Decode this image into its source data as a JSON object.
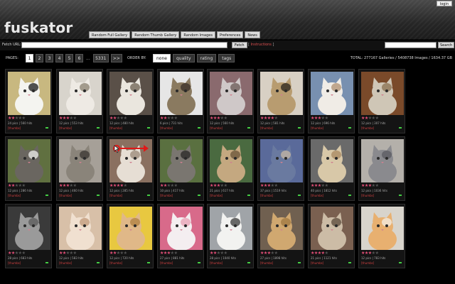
{
  "header": {
    "logo": "fuskator",
    "login_label": "login",
    "tabs": [
      "Random Full Gallery",
      "Random Thumb Gallery",
      "Random Images",
      "Preferences",
      "News"
    ]
  },
  "fetch": {
    "label": "Fetch URL:",
    "button": "Fetch",
    "instructions_prefix": "[ ",
    "instructions": "Instructions",
    "instructions_suffix": " ]",
    "search_button": "Search"
  },
  "pager": {
    "label": "PAGES:",
    "pages": [
      "1",
      "2",
      "3",
      "4",
      "5",
      "6"
    ],
    "active_page": "1",
    "ellipsis": "...",
    "last_page": "5331",
    "next": ">>",
    "order_label": "ORDER BY:",
    "order_options": [
      "none",
      "quality",
      "rating",
      "tags"
    ],
    "active_order": "none",
    "total": "TOTAL: 277167 Galleries / 5408738 Images / 1634.37 GB"
  },
  "colors": {
    "accent": "#e8507a",
    "link": "#d04040",
    "background": "#000000"
  },
  "annotation": {
    "icon": "red-arrow-annotation",
    "cursor": "hand-cursor-icon"
  },
  "galleries": [
    {
      "info": "24 pics | 560 hits",
      "rating": 2,
      "votes": "",
      "thumbs": "[thumbs]",
      "bg": "#c8b880",
      "cat": "#f4f4f0",
      "patch": "#1a1a1a"
    },
    {
      "info": "12 pics | 553 hits",
      "rating": 3,
      "votes": "",
      "thumbs": "[thumbs]",
      "bg": "#d8d4cc",
      "cat": "#eeeae4",
      "patch": "#8a8070"
    },
    {
      "info": "12 pics | 480 hits",
      "rating": 2,
      "votes": "",
      "thumbs": "[thumbs]",
      "bg": "#5a5048",
      "cat": "#eae6de",
      "patch": "#6c6050"
    },
    {
      "info": "6 pics | 731 hits",
      "rating": 2,
      "votes": "",
      "thumbs": "[thumbs]",
      "bg": "#e6e6e6",
      "cat": "#8a7a60",
      "patch": "#3a3028"
    },
    {
      "info": "12 pics | 560 hits",
      "rating": 3,
      "votes": "",
      "thumbs": "[thumbs]",
      "bg": "#8a6a6e",
      "cat": "#cfc8c8",
      "patch": "#6a5a56"
    },
    {
      "info": "12 pics | 581 hits",
      "rating": 4,
      "votes": "",
      "thumbs": "[thumbs]",
      "bg": "#d8d0c4",
      "cat": "#b89c70",
      "patch": "#2a241e"
    },
    {
      "info": "12 pics | 696 hits",
      "rating": 3,
      "votes": "",
      "thumbs": "[thumbs]",
      "bg": "#7890b0",
      "cat": "#f0ece6",
      "patch": "#b09070"
    },
    {
      "info": "12 pics | 307 hits",
      "rating": 2,
      "votes": "",
      "thumbs": "[thumbs]",
      "bg": "#7a4a2a",
      "cat": "#cfc6b6",
      "patch": "#8a7050"
    },
    {
      "info": "12 pics | 286 hits",
      "rating": 2,
      "votes": "",
      "thumbs": "[thumbs]",
      "bg": "#607040",
      "cat": "#6a6660",
      "patch": "#f0f0ee"
    },
    {
      "info": "12 pics | 460 hits",
      "rating": 3,
      "votes": "",
      "thumbs": "[thumbs]",
      "bg": "#a6a098",
      "cat": "#8a847a",
      "patch": "#3a3632"
    },
    {
      "info": "12 pics | 285 hits",
      "rating": 4,
      "votes": "",
      "thumbs": "[thumbs]",
      "bg": "#8a7060",
      "cat": "#e6ded4",
      "patch": "#9a8878"
    },
    {
      "info": "10 pics | 417 hits",
      "rating": 2,
      "votes": "",
      "thumbs": "[thumbs]",
      "bg": "#5a7040",
      "cat": "#7a7670",
      "patch": "#2a2826"
    },
    {
      "info": "21 pics | 617 hits",
      "rating": 3,
      "votes": "",
      "thumbs": "[thumbs]",
      "bg": "#4a6a40",
      "cat": "#c4a880",
      "patch": "#6a5438"
    },
    {
      "info": "37 pics | 1519 hits",
      "rating": 3,
      "votes": "",
      "thumbs": "[thumbs]",
      "bg": "#5a6a9a",
      "cat": "#6a7aa0",
      "patch": "#c8b8a4"
    },
    {
      "info": "40 pics | 1812 hits",
      "rating": 3,
      "votes": "",
      "thumbs": "[thumbs]",
      "bg": "#6a6a6a",
      "cat": "#d8c8a8",
      "patch": "#a88860"
    },
    {
      "info": "12 pics | 1036 hits",
      "rating": 3,
      "votes": "",
      "thumbs": "[thumbs]",
      "bg": "#b4b0aa",
      "cat": "#8a8a8e",
      "patch": "#5a5a60"
    },
    {
      "info": "28 pics | 683 hits",
      "rating": 2,
      "votes": "",
      "thumbs": "[thumbs]",
      "bg": "#3a3a3a",
      "cat": "#9a9a9a",
      "patch": "#5a5a5a"
    },
    {
      "info": "12 pics | 583 hits",
      "rating": 2,
      "votes": "",
      "thumbs": "[thumbs]",
      "bg": "#d8c0a8",
      "cat": "#f0e0d0",
      "patch": "#c09878"
    },
    {
      "info": "12 pics | 720 hits",
      "rating": 2,
      "votes": "",
      "thumbs": "[thumbs]",
      "bg": "#e8c840",
      "cat": "#e0b888",
      "patch": "#b08040"
    },
    {
      "info": "27 pics | 881 hits",
      "rating": 3,
      "votes": "",
      "thumbs": "[thumbs]",
      "bg": "#d86a8a",
      "cat": "#f4eef0",
      "patch": "#e8a0b4"
    },
    {
      "info": "28 pics | 1040 hits",
      "rating": 2,
      "votes": "",
      "thumbs": "[thumbs]",
      "bg": "#a0a4a8",
      "cat": "#f2f2f0",
      "patch": "#3a3a3a"
    },
    {
      "info": "27 pics | 1898 hits",
      "rating": 3,
      "votes": "",
      "thumbs": "[thumbs]",
      "bg": "#706050",
      "cat": "#d0a870",
      "patch": "#a07840"
    },
    {
      "info": "21 pics | 1121 hits",
      "rating": 4,
      "votes": "",
      "thumbs": "[thumbs]",
      "bg": "#7a6050",
      "cat": "#ccbca6",
      "patch": "#5a4a3a"
    },
    {
      "info": "12 pics | 783 hits",
      "rating": 3,
      "votes": "",
      "thumbs": "[thumbs]",
      "bg": "#d8d4cc",
      "cat": "#e8b070",
      "patch": "#f4efe6"
    }
  ]
}
